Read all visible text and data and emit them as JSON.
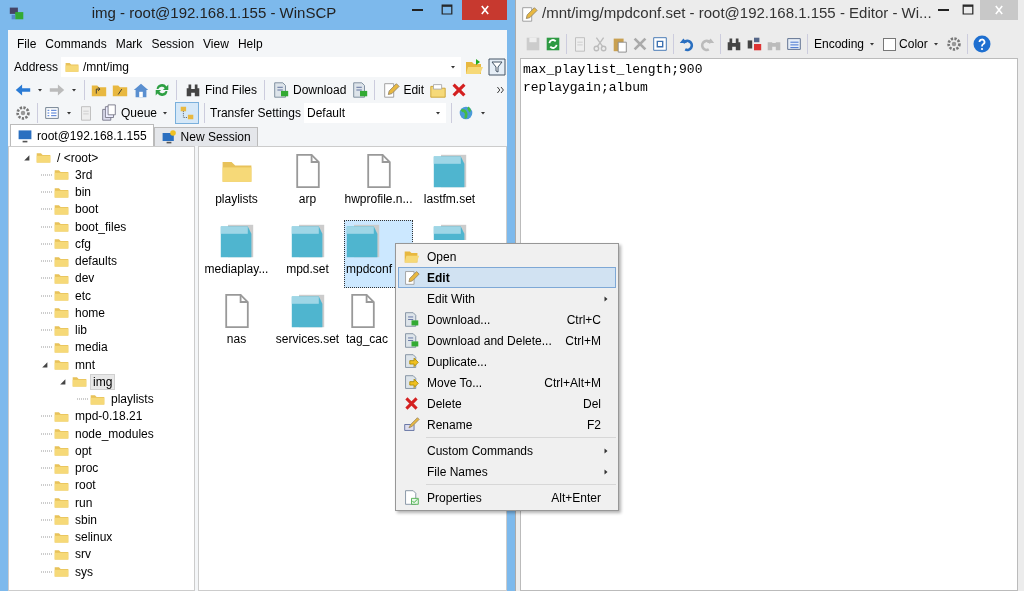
{
  "left_window": {
    "title": "img - root@192.168.1.155 - WinSCP",
    "menu": [
      "File",
      "Commands",
      "Mark",
      "Session",
      "View",
      "Help"
    ],
    "address": {
      "label": "Address",
      "value": "/mnt/img"
    },
    "toolbar": {
      "find": "Find Files",
      "download": "Download",
      "edit": "Edit"
    },
    "toolbar2": {
      "queue": "Queue",
      "transfer_label": "Transfer Settings",
      "transfer_value": "Default"
    },
    "tabs": [
      {
        "label": "root@192.168.1.155",
        "selected": true
      },
      {
        "label": "New Session",
        "selected": false
      }
    ],
    "tree": {
      "label": "/ <root>",
      "expanded": true,
      "selected": false,
      "children": [
        {
          "label": "3rd",
          "selected": false
        },
        {
          "label": "bin",
          "selected": false
        },
        {
          "label": "boot",
          "selected": false
        },
        {
          "label": "boot_files",
          "selected": false
        },
        {
          "label": "cfg",
          "selected": false
        },
        {
          "label": "defaults",
          "selected": false
        },
        {
          "label": "dev",
          "selected": false
        },
        {
          "label": "etc",
          "selected": false
        },
        {
          "label": "home",
          "selected": false
        },
        {
          "label": "lib",
          "selected": false
        },
        {
          "label": "media",
          "selected": false
        },
        {
          "label": "mnt",
          "expanded": true,
          "selected": false,
          "children": [
            {
              "label": "img",
              "expanded": true,
              "selected": true,
              "children": [
                {
                  "label": "playlists",
                  "selected": false
                }
              ]
            }
          ]
        },
        {
          "label": "mpd-0.18.21",
          "selected": false
        },
        {
          "label": "node_modules",
          "selected": false
        },
        {
          "label": "opt",
          "selected": false
        },
        {
          "label": "proc",
          "selected": false
        },
        {
          "label": "root",
          "selected": false
        },
        {
          "label": "run",
          "selected": false
        },
        {
          "label": "sbin",
          "selected": false
        },
        {
          "label": "selinux",
          "selected": false
        },
        {
          "label": "srv",
          "selected": false
        },
        {
          "label": "sys",
          "selected": false
        }
      ]
    },
    "files": [
      {
        "name": "playlists",
        "kind": "folder",
        "selected": false
      },
      {
        "name": "arp",
        "kind": "file",
        "selected": false
      },
      {
        "name": "hwprofile.n...",
        "kind": "file",
        "selected": false
      },
      {
        "name": "lastfm.set",
        "kind": "text",
        "selected": false
      },
      {
        "name": "mediaplay...",
        "kind": "text",
        "selected": false
      },
      {
        "name": "mpd.set",
        "kind": "text",
        "selected": false
      },
      {
        "name": "mpdconf",
        "kind": "text",
        "selected": true
      },
      {
        "kind": "text",
        "selected": false
      },
      {
        "name": "nas",
        "kind": "file",
        "selected": false
      },
      {
        "name": "services.set",
        "kind": "text",
        "selected": false
      },
      {
        "name": "tag_cac",
        "kind": "file",
        "selected": false
      }
    ]
  },
  "context_menu": {
    "groups": [
      [
        {
          "label": "Open",
          "submenu": false,
          "selected": false
        },
        {
          "label": "Edit",
          "submenu": false,
          "selected": true,
          "bold": true
        },
        {
          "label": "Edit With",
          "submenu": true,
          "selected": false
        },
        {
          "label": "Download...",
          "shortcut": "Ctrl+C",
          "submenu": false,
          "selected": false
        },
        {
          "label": "Download and Delete...",
          "shortcut": "Ctrl+M",
          "submenu": false,
          "selected": false
        },
        {
          "label": "Duplicate...",
          "submenu": false,
          "selected": false
        },
        {
          "label": "Move To...",
          "shortcut": "Ctrl+Alt+M",
          "submenu": false,
          "selected": false
        },
        {
          "label": "Delete",
          "shortcut": "Del",
          "submenu": false,
          "selected": false
        },
        {
          "label": "Rename",
          "shortcut": "F2",
          "submenu": false,
          "selected": false
        }
      ],
      [
        {
          "label": "Custom Commands",
          "submenu": true,
          "selected": false
        },
        {
          "label": "File Names",
          "submenu": true,
          "selected": false
        }
      ],
      [
        {
          "label": "Properties",
          "shortcut": "Alt+Enter",
          "submenu": false,
          "selected": false
        }
      ]
    ]
  },
  "editor_window": {
    "title": "/mnt/img/mpdconf.set - root@192.168.1.155 - Editor - Wi...",
    "toolbar": {
      "encoding": "Encoding",
      "color": {
        "label": "Color",
        "checked": false
      }
    },
    "lines": [
      "max_playlist_length;900",
      "replaygain;album"
    ]
  }
}
